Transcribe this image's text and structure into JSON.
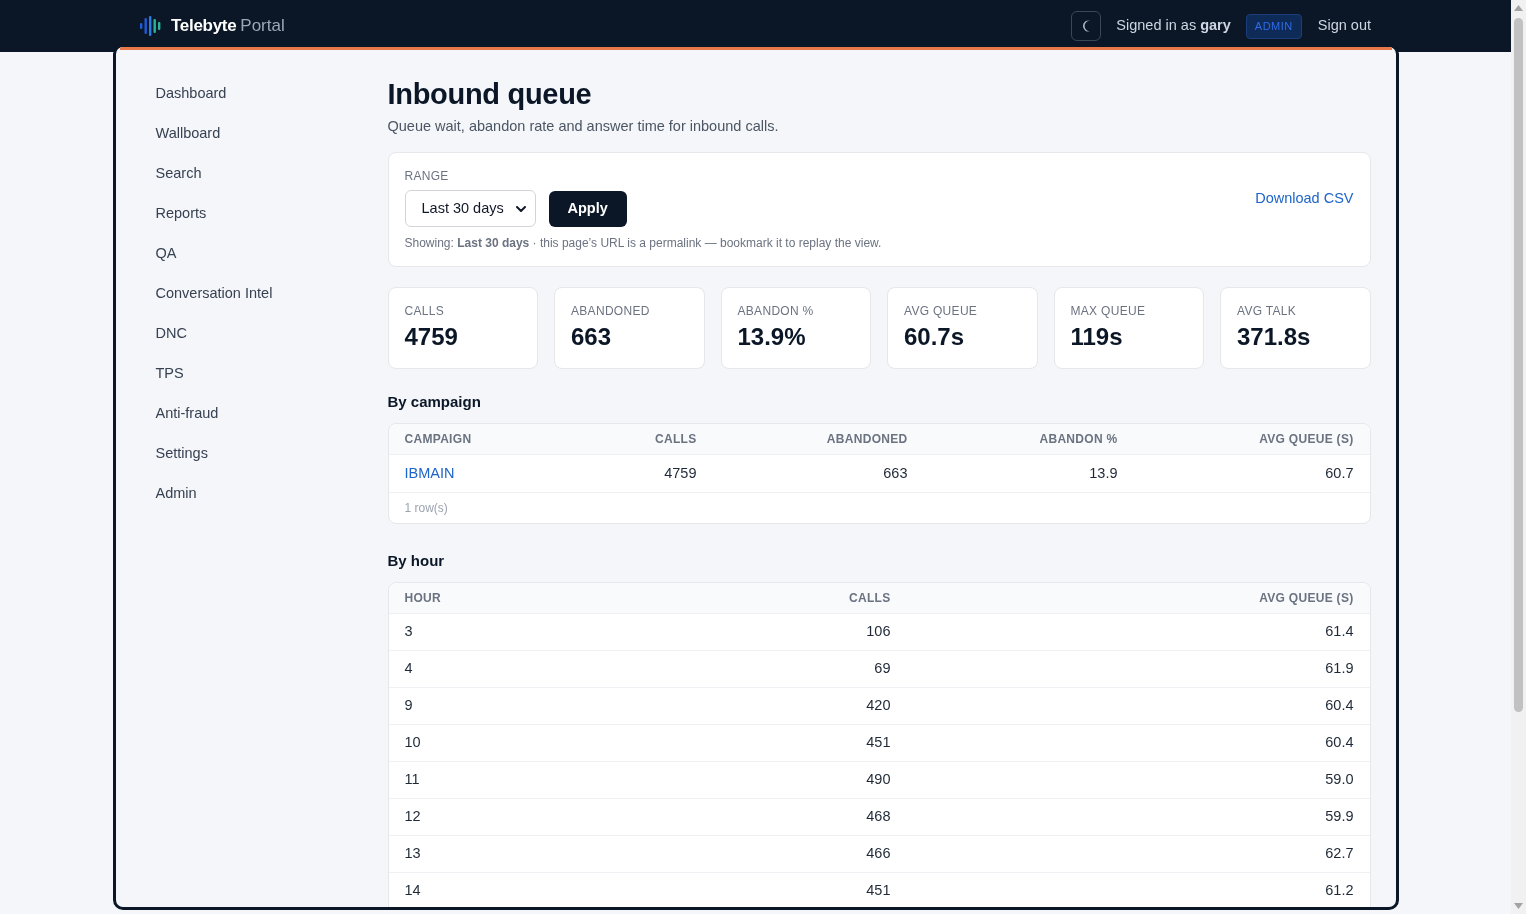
{
  "header": {
    "brand": {
      "name": "Telebyte",
      "suffix": "Portal"
    },
    "signed_in": "Signed in as **gary**",
    "role_badge": "ADMIN",
    "sign_out": "Sign out"
  },
  "sidebar": {
    "items": [
      {
        "label": "Dashboard"
      },
      {
        "label": "Wallboard"
      },
      {
        "label": "Search"
      },
      {
        "label": "Reports"
      },
      {
        "label": "QA"
      },
      {
        "label": "Conversation Intel"
      },
      {
        "label": "DNC"
      },
      {
        "label": "TPS"
      },
      {
        "label": "Anti-fraud"
      },
      {
        "label": "Settings"
      },
      {
        "label": "Admin"
      }
    ]
  },
  "page": {
    "title": "Inbound queue",
    "subtitle": "Queue wait, abandon rate and answer time for inbound calls."
  },
  "filter": {
    "label": "RANGE",
    "select": {
      "value": "Last 30 days"
    },
    "apply": "Apply",
    "download": "Download CSV",
    "note": "Showing: **Last 30 days** · this page’s URL is a permalink — bookmark it to replay the view."
  },
  "stats": [
    {
      "label": "CALLS",
      "value": "4759"
    },
    {
      "label": "ABANDONED",
      "value": "663"
    },
    {
      "label": "ABANDON %",
      "value": "13.9%"
    },
    {
      "label": "AVG QUEUE",
      "value": "60.7s"
    },
    {
      "label": "MAX QUEUE",
      "value": "119s"
    },
    {
      "label": "AVG TALK",
      "value": "371.8s"
    }
  ],
  "by_campaign": {
    "title": "By campaign",
    "table": {
      "columns": [
        "CAMPAIGN",
        "CALLS",
        "ABANDONED",
        "ABANDON %",
        "AVG QUEUE (S)"
      ],
      "rows": [
        {
          "campaign": "IBMAIN",
          "values": [
            "4759",
            "663",
            "13.9",
            "60.7"
          ]
        }
      ],
      "footer": "1 row(s)"
    }
  },
  "by_hour": {
    "title": "By hour",
    "table": {
      "columns": [
        "HOUR",
        "CALLS",
        "AVG QUEUE (S)"
      ],
      "rows": [
        [
          "3",
          "106",
          "61.4"
        ],
        [
          "4",
          "69",
          "61.9"
        ],
        [
          "9",
          "420",
          "60.4"
        ],
        [
          "10",
          "451",
          "60.4"
        ],
        [
          "11",
          "490",
          "59.0"
        ],
        [
          "12",
          "468",
          "59.9"
        ],
        [
          "13",
          "466",
          "62.7"
        ],
        [
          "14",
          "451",
          "61.2"
        ]
      ]
    }
  }
}
